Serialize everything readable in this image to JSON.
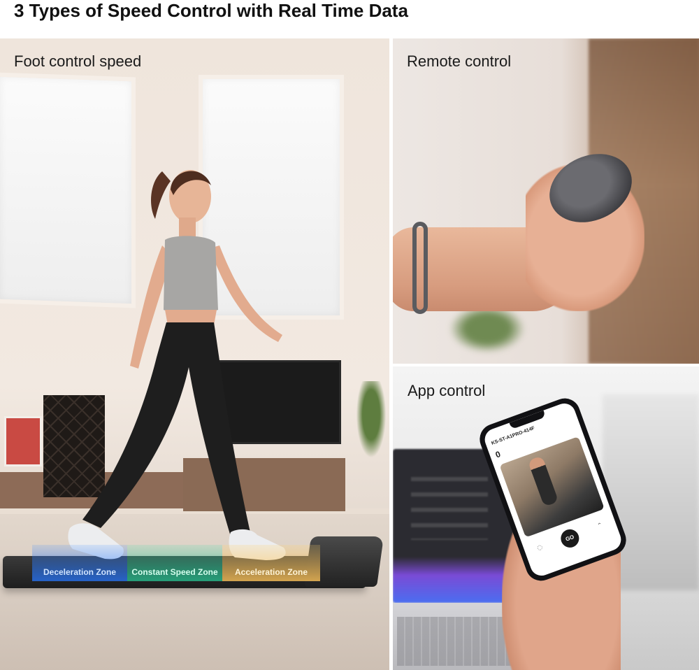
{
  "title": "3 Types of Speed Control with Real Time Data",
  "panels": {
    "foot": {
      "label": "Foot control speed",
      "zones": {
        "deceleration": "Deceleration Zone",
        "constant": "Constant Speed Zone",
        "acceleration": "Acceleration Zone"
      }
    },
    "remote": {
      "label": "Remote control"
    },
    "app": {
      "label": "App control",
      "device_name": "KS-ST-A1PRO-414F",
      "stat_value": "0",
      "go_label": "GO"
    }
  },
  "colors": {
    "deceleration_zone": "#3c8cff",
    "constant_zone": "#28c896",
    "acceleration_zone": "#ffc45a"
  },
  "icons": [
    "wristband-icon",
    "remote-icon",
    "smartphone-icon"
  ]
}
